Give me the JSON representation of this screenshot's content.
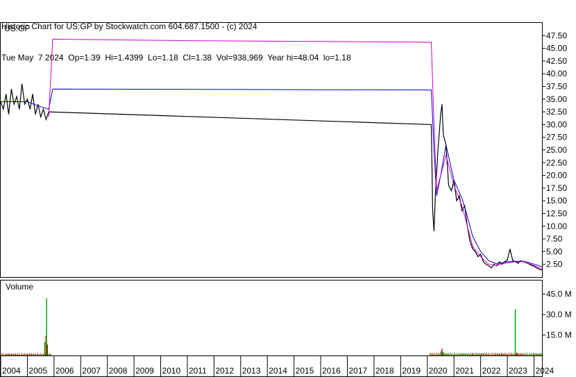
{
  "header": {
    "line1": "Historic Chart for US:GP by Stockwatch.com 604.687.1500 - (c) 2024",
    "line2": "Tue May  7 2024  Op=1.39  Hi=1.4399  Lo=1.18  Cl=1.38  Vol=938,969  Year hi=48.04  lo=1.18"
  },
  "chart_data": [
    {
      "type": "line",
      "panel_label": "US:GP",
      "y_ticks": [
        "2.50",
        "5.00",
        "7.50",
        "10.00",
        "12.50",
        "15.00",
        "17.50",
        "20.00",
        "22.50",
        "25.00",
        "27.50",
        "30.00",
        "32.50",
        "35.00",
        "37.50",
        "40.00",
        "42.50",
        "45.00",
        "47.50"
      ],
      "ylim": [
        0,
        50
      ],
      "x_ticks": [
        "2004",
        "2005",
        "2006",
        "2007",
        "2008",
        "2009",
        "2010",
        "2011",
        "2012",
        "2013",
        "2014",
        "2015",
        "2016",
        "2017",
        "2018",
        "2019",
        "2020",
        "2021",
        "2022",
        "2023",
        "2024"
      ],
      "series": [
        {
          "color": "#000000",
          "points": [
            [
              2004.0,
              34.5
            ],
            [
              2004.1,
              33
            ],
            [
              2004.2,
              36
            ],
            [
              2004.3,
              32
            ],
            [
              2004.4,
              37
            ],
            [
              2004.5,
              34
            ],
            [
              2004.6,
              35.5
            ],
            [
              2004.7,
              33
            ],
            [
              2004.8,
              38
            ],
            [
              2004.9,
              34
            ],
            [
              2005.0,
              35
            ],
            [
              2005.1,
              33
            ],
            [
              2005.2,
              36
            ],
            [
              2005.3,
              32
            ],
            [
              2005.4,
              34
            ],
            [
              2005.5,
              31.5
            ],
            [
              2005.6,
              33
            ],
            [
              2005.7,
              31
            ],
            [
              2005.8,
              32.5
            ],
            [
              2020.15,
              30
            ],
            [
              2020.2,
              13
            ],
            [
              2020.25,
              9
            ],
            [
              2020.3,
              16
            ],
            [
              2020.4,
              25
            ],
            [
              2020.5,
              32
            ],
            [
              2020.55,
              34
            ],
            [
              2020.6,
              28
            ],
            [
              2020.7,
              26
            ],
            [
              2020.8,
              18
            ],
            [
              2020.9,
              17
            ],
            [
              2021.0,
              19
            ],
            [
              2021.1,
              15
            ],
            [
              2021.2,
              16
            ],
            [
              2021.3,
              13
            ],
            [
              2021.4,
              14
            ],
            [
              2021.5,
              10
            ],
            [
              2021.6,
              7
            ],
            [
              2021.7,
              5.5
            ],
            [
              2021.8,
              5
            ],
            [
              2021.9,
              4
            ],
            [
              2022.0,
              4.5
            ],
            [
              2022.1,
              3
            ],
            [
              2022.2,
              2.5
            ],
            [
              2022.3,
              2.2
            ],
            [
              2022.4,
              1.8
            ],
            [
              2022.5,
              2.5
            ],
            [
              2022.6,
              2.2
            ],
            [
              2022.7,
              3
            ],
            [
              2022.8,
              2.5
            ],
            [
              2022.9,
              3
            ],
            [
              2023.0,
              3.3
            ],
            [
              2023.1,
              5.5
            ],
            [
              2023.2,
              3.3
            ],
            [
              2023.3,
              3
            ],
            [
              2023.4,
              2.7
            ],
            [
              2023.5,
              3.2
            ],
            [
              2023.6,
              3
            ],
            [
              2023.7,
              2.8
            ],
            [
              2023.8,
              2.6
            ],
            [
              2023.9,
              2.3
            ],
            [
              2024.0,
              2.1
            ],
            [
              2024.1,
              1.8
            ],
            [
              2024.2,
              1.5
            ],
            [
              2024.3,
              1.38
            ]
          ]
        },
        {
          "color": "#0000cc",
          "points": [
            [
              2004.0,
              34.5
            ],
            [
              2004.5,
              34.5
            ],
            [
              2005.0,
              34.5
            ],
            [
              2005.5,
              33.5
            ],
            [
              2005.8,
              33
            ],
            [
              2005.95,
              37
            ],
            [
              2013.0,
              36.9
            ],
            [
              2020.15,
              36.8
            ],
            [
              2020.25,
              25
            ],
            [
              2020.35,
              16
            ],
            [
              2020.5,
              20
            ],
            [
              2020.7,
              26
            ],
            [
              2021.0,
              19
            ],
            [
              2021.3,
              15.5
            ],
            [
              2021.5,
              12
            ],
            [
              2021.7,
              8
            ],
            [
              2022.0,
              5
            ],
            [
              2022.3,
              3.2
            ],
            [
              2022.6,
              2.6
            ],
            [
              2023.0,
              3
            ],
            [
              2023.3,
              3.1
            ],
            [
              2023.6,
              3.1
            ],
            [
              2023.9,
              2.7
            ],
            [
              2024.2,
              2.2
            ],
            [
              2024.3,
              2
            ]
          ]
        },
        {
          "color": "#cc00cc",
          "points": [
            [
              2005.8,
              31.5
            ],
            [
              2005.95,
              46.8
            ],
            [
              2011.0,
              46.5
            ],
            [
              2020.15,
              46.2
            ],
            [
              2020.25,
              30
            ],
            [
              2020.35,
              17
            ],
            [
              2020.5,
              20
            ],
            [
              2020.7,
              24
            ],
            [
              2021.0,
              18
            ],
            [
              2021.3,
              14
            ],
            [
              2021.5,
              10
            ],
            [
              2021.7,
              6
            ],
            [
              2022.0,
              4
            ],
            [
              2022.3,
              2.5
            ],
            [
              2022.6,
              2.3
            ],
            [
              2023.0,
              2.8
            ],
            [
              2023.3,
              3
            ],
            [
              2023.6,
              3
            ],
            [
              2023.9,
              2.5
            ],
            [
              2024.2,
              1.8
            ],
            [
              2024.3,
              1.6
            ]
          ]
        }
      ]
    },
    {
      "type": "bar",
      "panel_label": "Volume",
      "y_ticks": [
        "15.0 M",
        "30.0 M",
        "45.0 M"
      ],
      "ylim": [
        0,
        55
      ],
      "spikes": [
        [
          2005.65,
          10.0
        ],
        [
          2005.7,
          14.5
        ],
        [
          2005.72,
          42.0
        ],
        [
          2005.75,
          8.0
        ],
        [
          2020.5,
          3.0
        ],
        [
          2020.55,
          5.0
        ],
        [
          2020.6,
          2.5
        ],
        [
          2021.7,
          1.5
        ],
        [
          2023.3,
          34.0
        ],
        [
          2023.35,
          2.0
        ]
      ],
      "volume_colors": [
        "#00aa00",
        "#cc0000"
      ]
    }
  ]
}
